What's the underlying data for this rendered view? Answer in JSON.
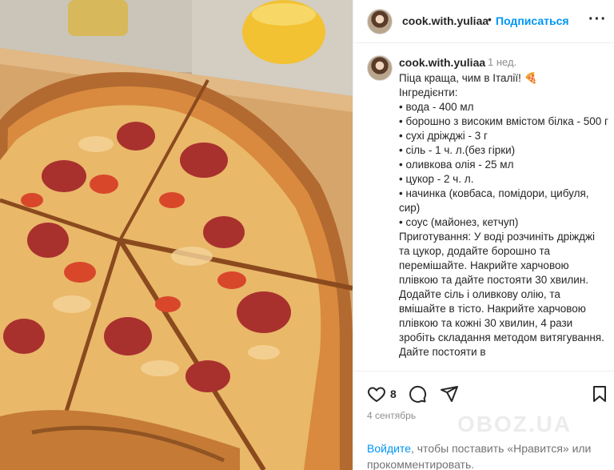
{
  "post": {
    "username": "cook.with.yuliaa",
    "separator": "•",
    "follow_label": "Подписаться",
    "more_label": "···"
  },
  "caption": {
    "username": "cook.with.yuliaa",
    "time": "1 нед.",
    "lines": [
      "Піца краща, чим в Італії! 🍕",
      "Інгредієнти:",
      "• вода - 400 мл",
      "• борошно з високим вмістом білка - 500 г",
      "• сухі дріжджі - 3 г",
      "• сіль - 1 ч. л.(без гірки)",
      "• оливкова олія - 25 мл",
      "• цукор - 2 ч. л.",
      "• начинка (ковбаса, помідори, цибуля, сир)",
      "• соус (майонез, кетчуп)",
      "Приготування: У воді розчиніть дріжджі та цукор, додайте борошно та перемішайте. Накрийте харчовою плівкою та дайте постояти 30 хвилин. Додайте сіль і оливкову олію, та вмішайте в тісто. Накрийте харчовою плівкою та кожні 30 хвилин, 4 рази зробіть складання методом витягування. Дайте постояти в"
    ]
  },
  "actions": {
    "likes": "8",
    "date": "4 сентябрь",
    "login_link": "Войдите",
    "login_rest": ", чтобы поставить «Нравится» или прокомментировать."
  },
  "watermark": "OBOZ.UA",
  "icons": [
    "heart-icon",
    "comment-icon",
    "share-icon",
    "bookmark-icon",
    "more-icon"
  ]
}
